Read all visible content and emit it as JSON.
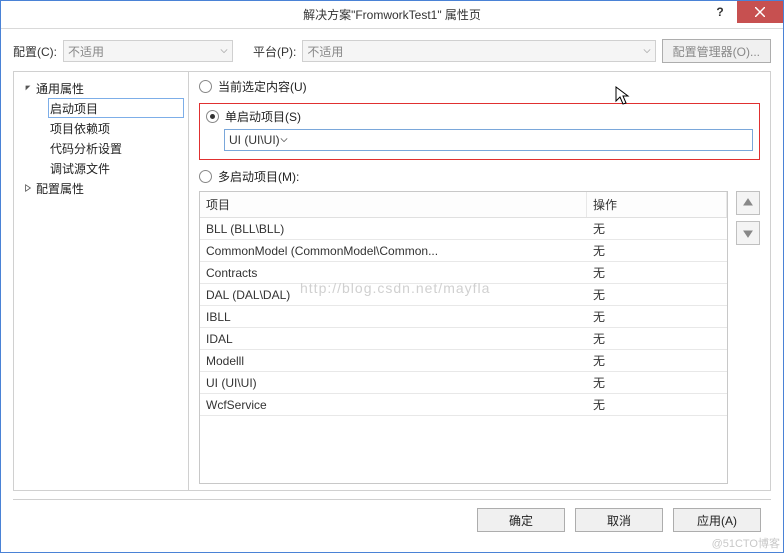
{
  "title": "解决方案\"FromworkTest1\" 属性页",
  "toprow": {
    "config_label": "配置(C):",
    "config_value": "不适用",
    "platform_label": "平台(P):",
    "platform_value": "不适用",
    "manager_btn": "配置管理器(O)..."
  },
  "sidebar": {
    "root1": "通用属性",
    "root1_children": [
      "启动项目",
      "项目依赖项",
      "代码分析设置",
      "调试源文件"
    ],
    "root1_selected": 0,
    "root2": "配置属性"
  },
  "radios": {
    "current": "当前选定内容(U)",
    "single": "单启动项目(S)",
    "single_value": "UI (UI\\UI)",
    "multi": "多启动项目(M):",
    "selected": "single"
  },
  "table": {
    "headers": [
      "项目",
      "操作"
    ],
    "rows": [
      [
        "BLL (BLL\\BLL)",
        "无"
      ],
      [
        "CommonModel (CommonModel\\Common...",
        "无"
      ],
      [
        "Contracts",
        "无"
      ],
      [
        "DAL (DAL\\DAL)",
        "无"
      ],
      [
        "IBLL",
        "无"
      ],
      [
        "IDAL",
        "无"
      ],
      [
        "Modelll",
        "无"
      ],
      [
        "UI (UI\\UI)",
        "无"
      ],
      [
        "WcfService",
        "无"
      ]
    ]
  },
  "footer": {
    "ok": "确定",
    "cancel": "取消",
    "apply": "应用(A)"
  },
  "watermark": "http://blog.csdn.net/mayfla",
  "blogmark": "@51CTO博客"
}
